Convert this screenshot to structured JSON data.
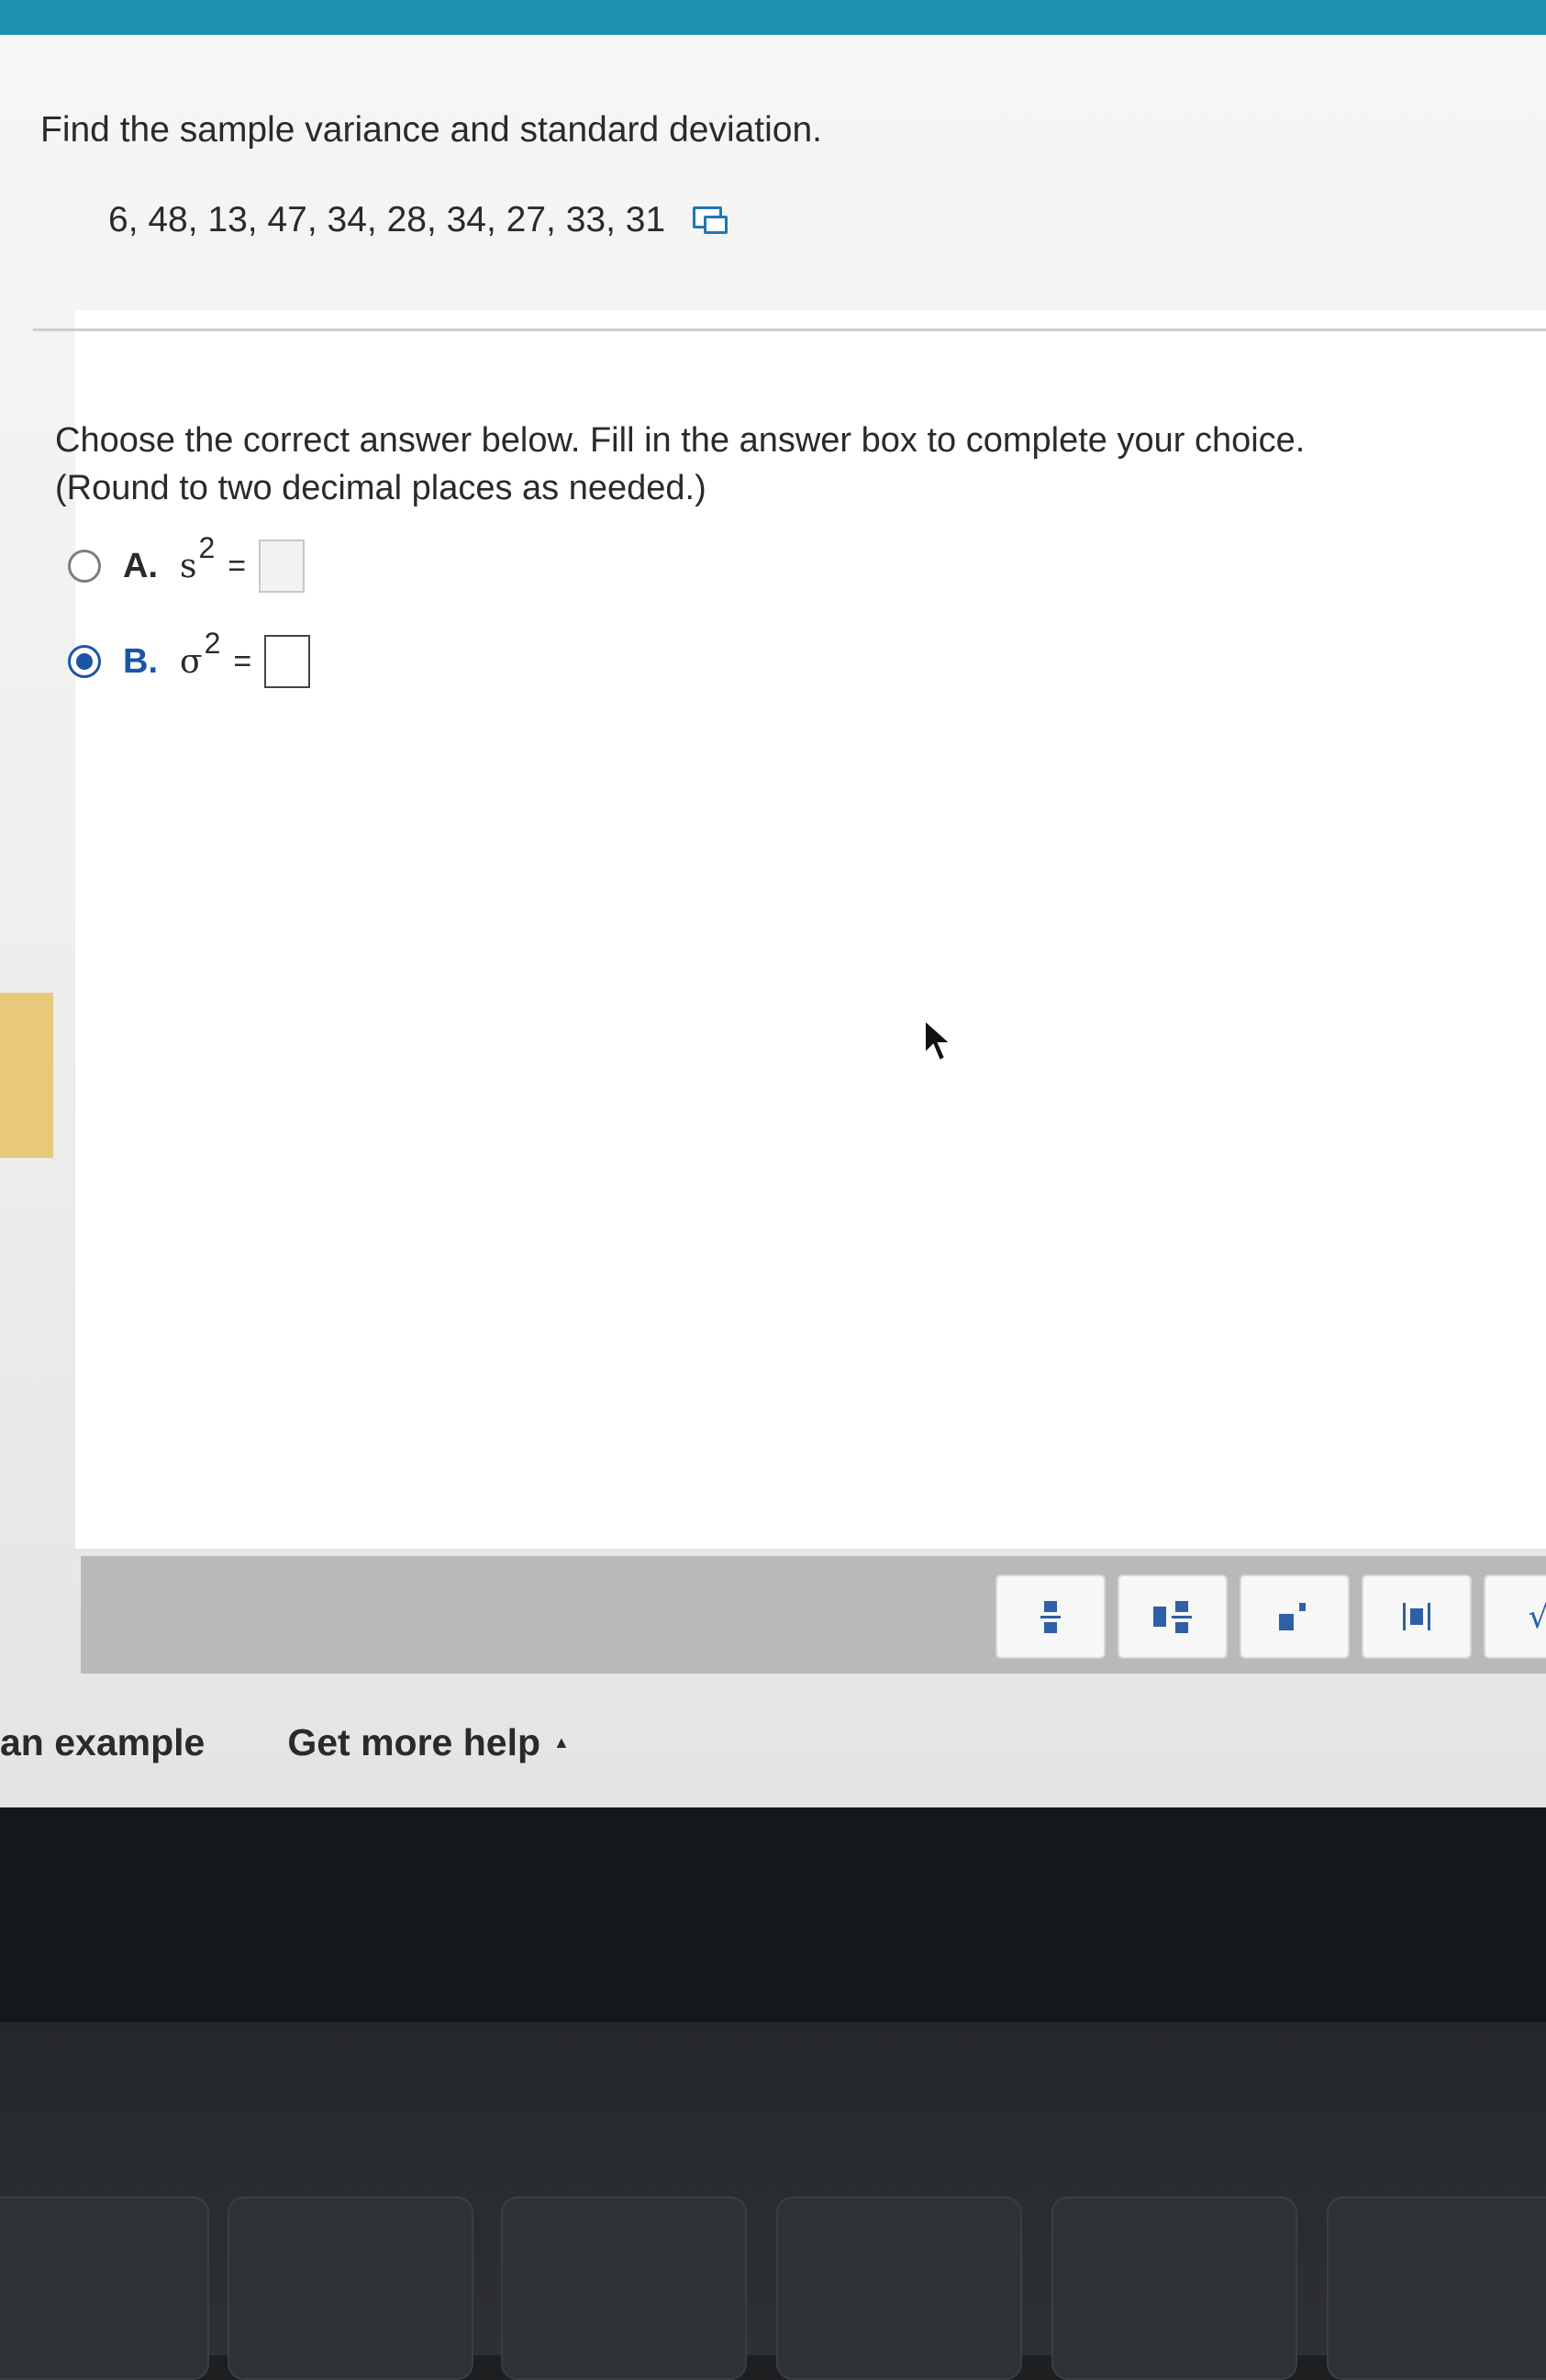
{
  "question": {
    "title": "Find the sample variance and standard deviation.",
    "data_values": "6, 48, 13, 47, 34, 28, 34, 27, 33, 31"
  },
  "instructions": {
    "line1": "Choose the correct answer below. Fill in the answer box to complete your choice.",
    "line2": "(Round to two decimal places as needed.)"
  },
  "options": [
    {
      "letter": "A.",
      "symbol": "s",
      "superscript": "2",
      "equals": "=",
      "selected": false,
      "answer": ""
    },
    {
      "letter": "B.",
      "symbol": "σ",
      "superscript": "2",
      "equals": "=",
      "selected": true,
      "answer": ""
    }
  ],
  "math_toolbar": {
    "buttons": [
      "fraction-icon",
      "mixed-number-icon",
      "exponent-icon",
      "absolute-value-icon",
      "square-root-icon"
    ],
    "sqrt_glyph": "√"
  },
  "help": {
    "example_label": "an example",
    "more_help_label": "Get more help",
    "more_help_caret": "▲"
  },
  "colors": {
    "accent_blue": "#1b55a8",
    "top_bar": "#1f8fb0",
    "toolbar_gray": "#b9b9b9"
  }
}
